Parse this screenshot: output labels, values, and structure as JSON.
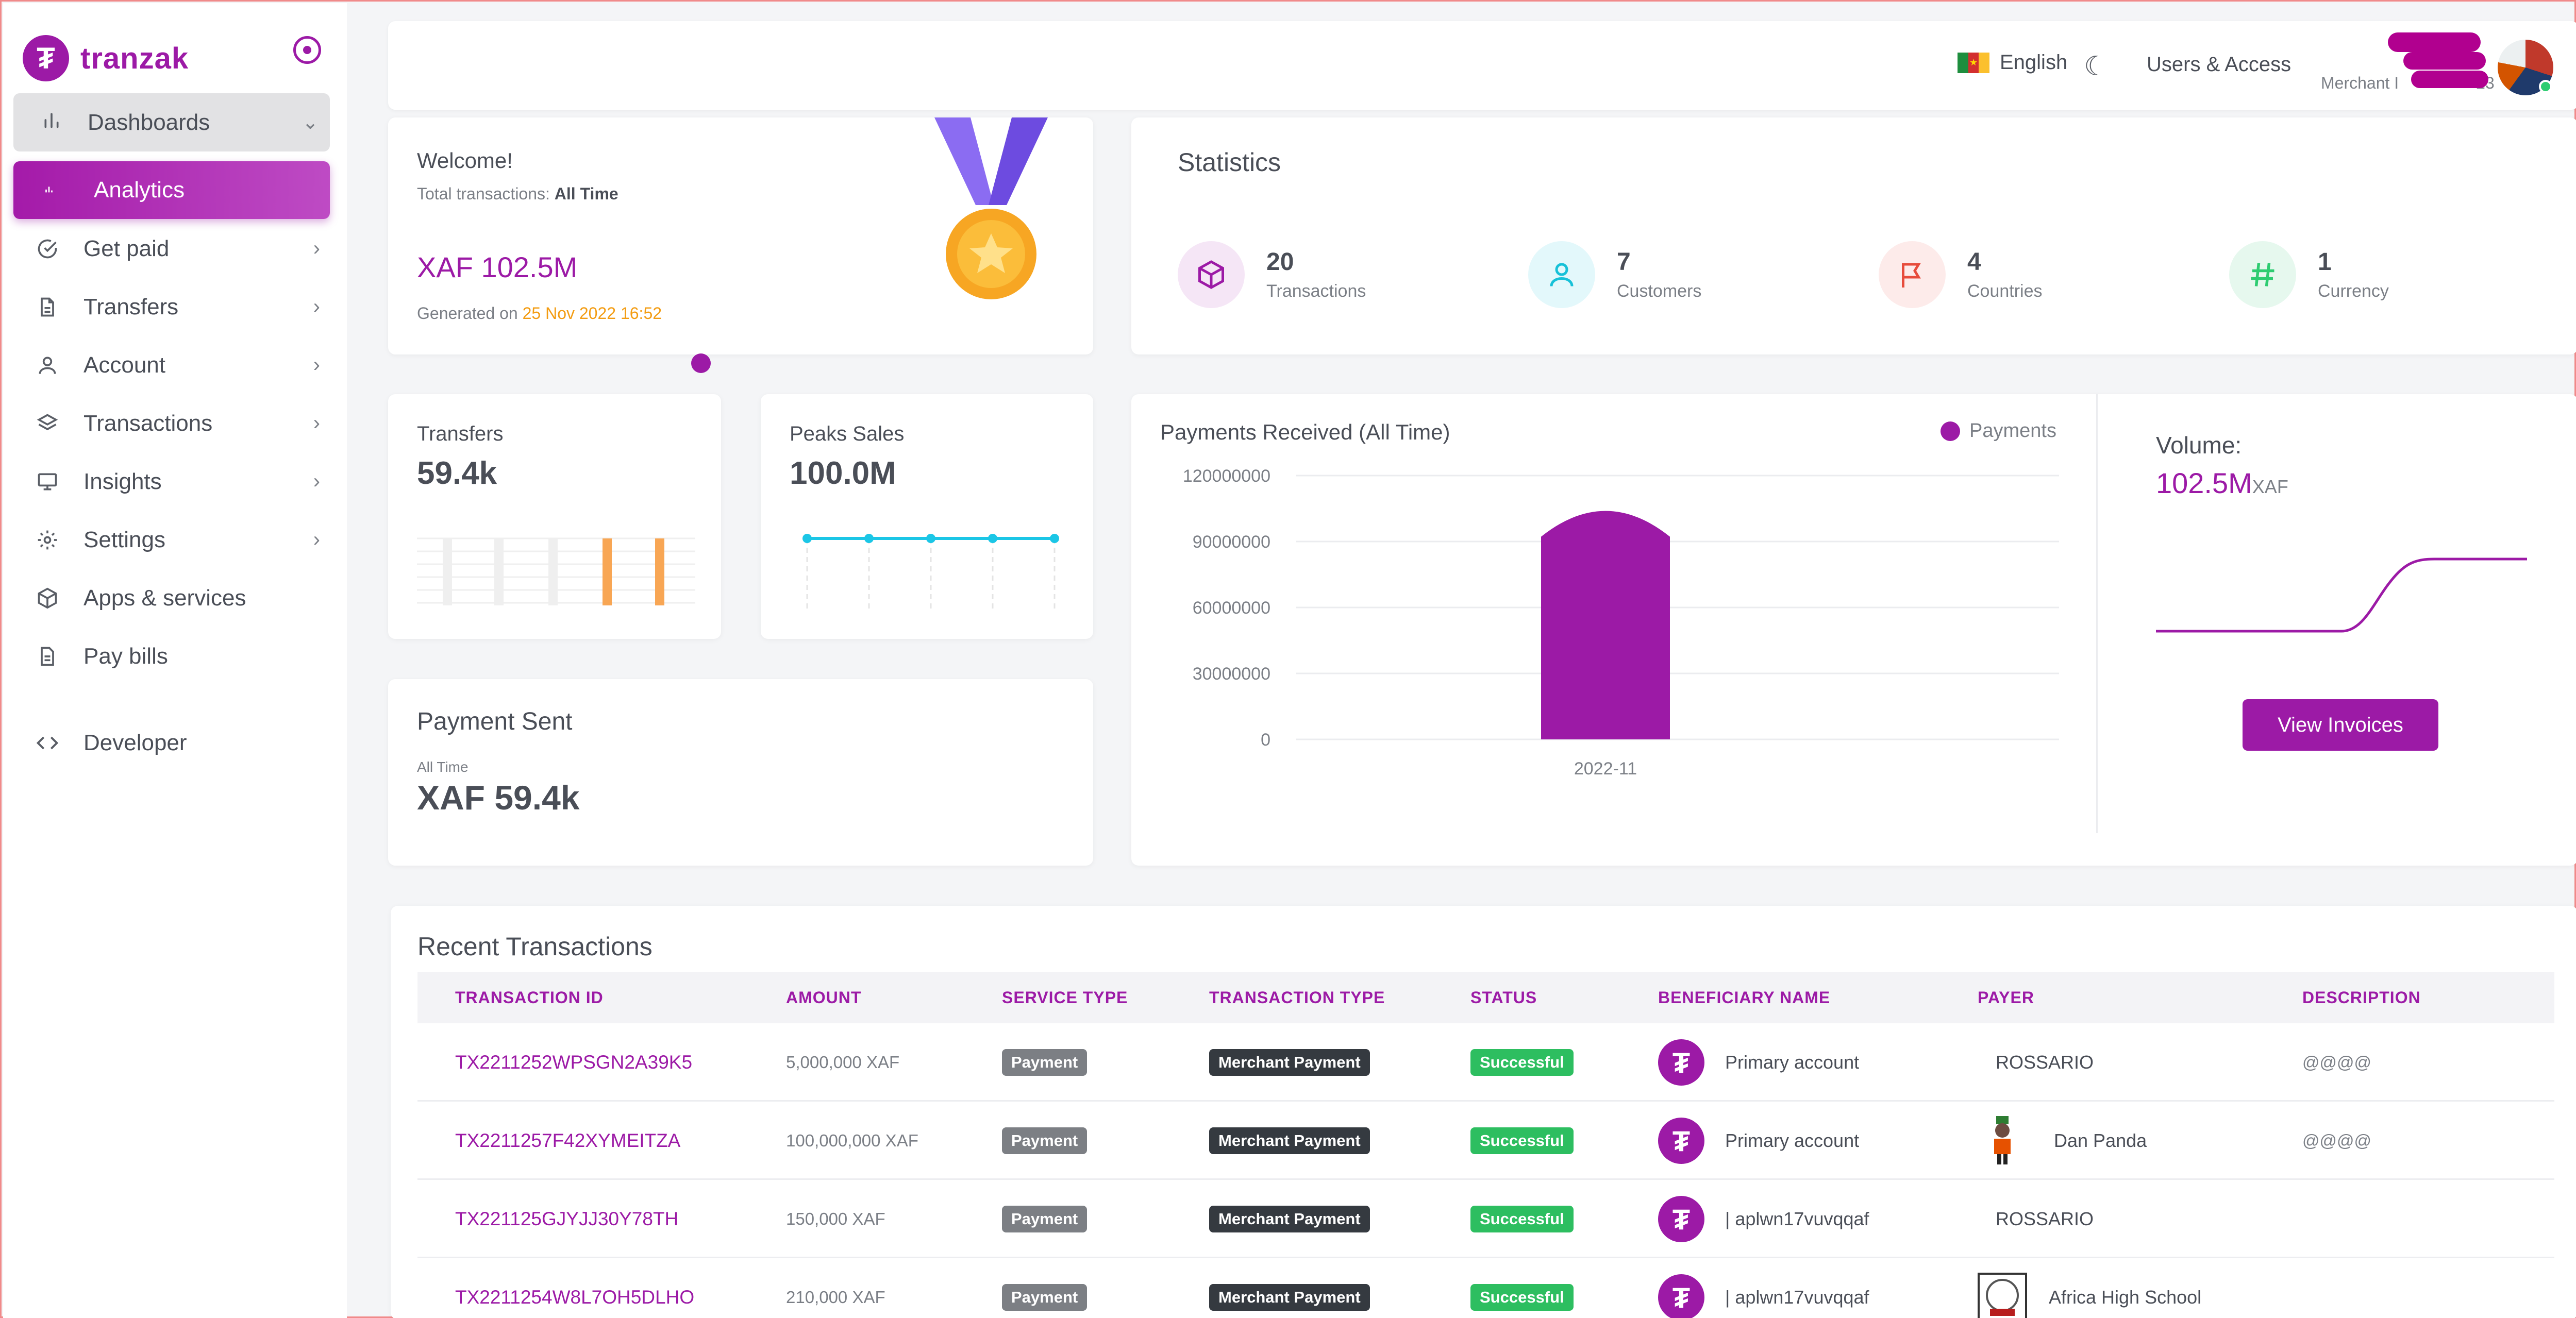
{
  "brand": {
    "name": "tranzak",
    "logo_glyph": "₮",
    "color": "#9C1AA6"
  },
  "sidebar": {
    "group": {
      "label": "Dashboards",
      "icon": "bar-chart-icon"
    },
    "active": {
      "label": "Analytics",
      "icon": "mini-bar-chart-icon"
    },
    "items": [
      {
        "label": "Get paid",
        "icon": "check-circle-icon",
        "chevron": true
      },
      {
        "label": "Transfers",
        "icon": "document-icon",
        "chevron": true
      },
      {
        "label": "Account",
        "icon": "user-icon",
        "chevron": true
      },
      {
        "label": "Transactions",
        "icon": "layers-icon",
        "chevron": true
      },
      {
        "label": "Insights",
        "icon": "monitor-icon",
        "chevron": true
      },
      {
        "label": "Settings",
        "icon": "gear-icon",
        "chevron": true
      },
      {
        "label": "Apps & services",
        "icon": "cube-icon",
        "chevron": false
      },
      {
        "label": "Pay bills",
        "icon": "file-icon",
        "chevron": false
      },
      {
        "label": "Developer",
        "icon": "code-icon",
        "chevron": false
      }
    ]
  },
  "topbar": {
    "language": "English",
    "users_access": "Users & Access",
    "merchant_label": "Merchant I",
    "merchant_id_tail": "23"
  },
  "welcome": {
    "title": "Welcome!",
    "total_label": "Total transactions: ",
    "total_period": "All Time",
    "amount": "XAF 102.5M",
    "generated_label": "Generated on ",
    "generated_date": "25 Nov 2022 16:52"
  },
  "statistics": {
    "title": "Statistics",
    "items": [
      {
        "value": "20",
        "label": "Transactions",
        "icon": "cube-icon",
        "color": "#9C1AA6",
        "bg": "#F5E6F6"
      },
      {
        "value": "7",
        "label": "Customers",
        "icon": "user-icon",
        "color": "#17C1D8",
        "bg": "#E3F8FB"
      },
      {
        "value": "4",
        "label": "Countries",
        "icon": "flag-icon",
        "color": "#E74C3C",
        "bg": "#FDEBEA"
      },
      {
        "value": "1",
        "label": "Currency",
        "icon": "hash-icon",
        "color": "#2ECC71",
        "bg": "#E6F8EE"
      }
    ]
  },
  "transfers_card": {
    "label": "Transfers",
    "value": "59.4k"
  },
  "peaks_card": {
    "label": "Peaks Sales",
    "value": "100.0M"
  },
  "payment_sent": {
    "title": "Payment Sent",
    "sub": "All Time",
    "value": "XAF 59.4k"
  },
  "volume": {
    "label": "Volume:",
    "value": "102.5M",
    "unit": "XAF"
  },
  "view_invoices": "View Invoices",
  "chart_data": {
    "type": "bar",
    "title": "Payments Received (All Time)",
    "categories": [
      "2022-11"
    ],
    "series": [
      {
        "name": "Payments",
        "values": [
          102500000
        ]
      }
    ],
    "yticks": [
      "0",
      "30000000",
      "60000000",
      "90000000",
      "120000000"
    ],
    "ylim": [
      0,
      120000000
    ],
    "grid": true,
    "legend": "top-right",
    "color": "#9C1AA6"
  },
  "recent": {
    "title": "Recent Transactions",
    "headers": [
      "TRANSACTION ID",
      "AMOUNT",
      "SERVICE TYPE",
      "TRANSACTION TYPE",
      "STATUS",
      "BENEFICIARY NAME",
      "PAYER",
      "DESCRIPTION"
    ],
    "rows": [
      {
        "id": "TX2211252WPSGN2A39K5",
        "amount": "5,000,000 XAF",
        "service": "Payment",
        "type": "Merchant Payment",
        "status": "Successful",
        "beneficiary": "Primary account",
        "payer": "ROSSARIO",
        "payer_avatar": "none",
        "description": "@@@@"
      },
      {
        "id": "TX2211257F42XYMEITZA",
        "amount": "100,000,000 XAF",
        "service": "Payment",
        "type": "Merchant Payment",
        "status": "Successful",
        "beneficiary": "Primary account",
        "payer": "Dan Panda",
        "payer_avatar": "person",
        "description": "@@@@"
      },
      {
        "id": "TX221125GJYJJ30Y78TH",
        "amount": "150,000 XAF",
        "service": "Payment",
        "type": "Merchant Payment",
        "status": "Successful",
        "beneficiary": "| aplwn17vuvqqaf",
        "payer": "ROSSARIO",
        "payer_avatar": "none",
        "description": ""
      },
      {
        "id": "TX2211254W8L7OH5DLHO",
        "amount": "210,000 XAF",
        "service": "Payment",
        "type": "Merchant Payment",
        "status": "Successful",
        "beneficiary": "| aplwn17vuvqqaf",
        "payer": "Africa High School",
        "payer_avatar": "school",
        "description": ""
      }
    ]
  }
}
